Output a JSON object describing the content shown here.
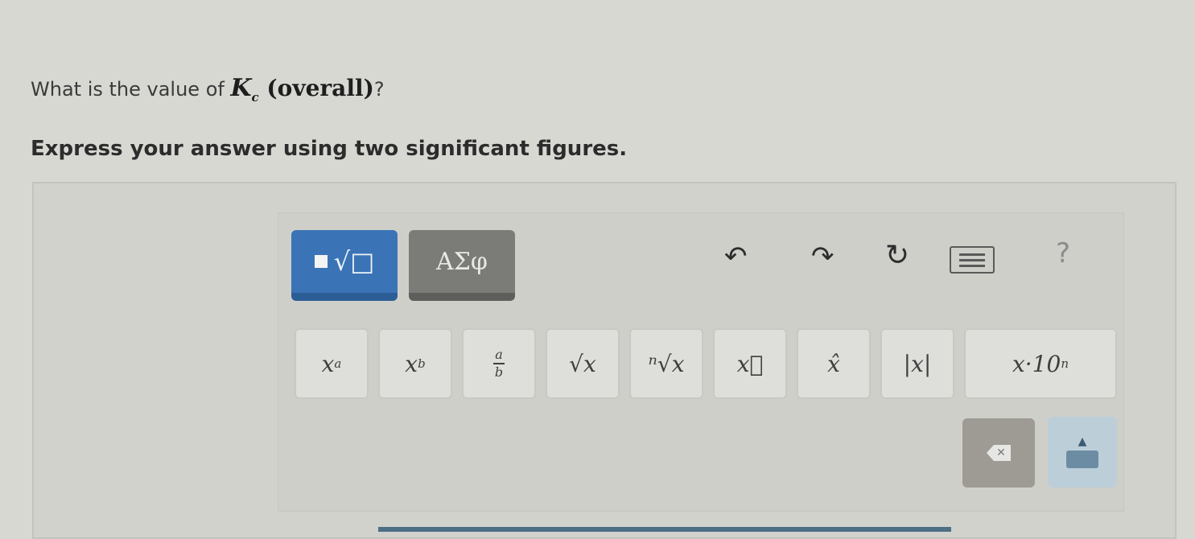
{
  "question": {
    "prefix": "What is the value of ",
    "symbol": "K",
    "subscript": "c",
    "suffix": " (overall)",
    "end": "?"
  },
  "instruction": "Express your answer using two significant figures.",
  "toolbar": {
    "tabs": [
      {
        "label": "√□",
        "selected": true
      },
      {
        "label": "ΑΣφ",
        "selected": false
      }
    ],
    "undo_icon": "undo-icon",
    "redo_icon": "redo-icon",
    "reset_icon": "reset-icon",
    "keyboard_icon": "keyboard-icon",
    "help_label": "?"
  },
  "keys": [
    {
      "name": "superscript",
      "base": "x",
      "mod": "a"
    },
    {
      "name": "subscript",
      "base": "x",
      "mod": "b"
    },
    {
      "name": "fraction",
      "num": "a",
      "den": "b"
    },
    {
      "name": "sqrt",
      "label": "√x"
    },
    {
      "name": "nth-root",
      "label": "ⁿ√x"
    },
    {
      "name": "vector",
      "label": "x⃗"
    },
    {
      "name": "unit-vector",
      "label": "x̂"
    },
    {
      "name": "absolute",
      "label": "|x|"
    },
    {
      "name": "scientific",
      "label": "x·10",
      "sup": "n"
    }
  ],
  "colors": {
    "templates_tab": "#3a74b6",
    "greek_tab": "#7b7b78",
    "backspace": "#9e9b94",
    "keyboard_toggle": "#bccfd9"
  }
}
